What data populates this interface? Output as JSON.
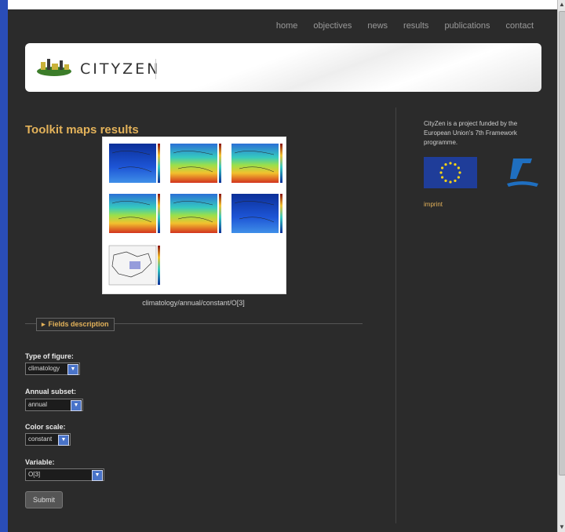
{
  "nav": {
    "items": [
      "home",
      "objectives",
      "news",
      "results",
      "publications",
      "contact"
    ]
  },
  "logo": {
    "text": "CITYZEN"
  },
  "main": {
    "title": "Toolkit maps results",
    "figure_caption": "climatology/annual/constant/O[3]",
    "fields_toggle": "Fields description"
  },
  "form": {
    "type_of_figure": {
      "label": "Type of figure:",
      "value": "climatology"
    },
    "annual_subset": {
      "label": "Annual subset:",
      "value": "annual"
    },
    "color_scale": {
      "label": "Color scale:",
      "value": "constant"
    },
    "variable": {
      "label": "Variable:",
      "value": "O[3]"
    },
    "submit_label": "Submit"
  },
  "sidebar": {
    "funding_text": "CityZen is a project funded by the European Union's 7th Framework programme.",
    "imprint_label": "imprint"
  },
  "colors": {
    "accent": "#e3b25a",
    "background": "#2b2b2b",
    "nav_text": "#9a9a9a"
  },
  "icons": {
    "select_arrow": "chevron-down-icon",
    "fields_toggle": "triangle-right-icon"
  }
}
